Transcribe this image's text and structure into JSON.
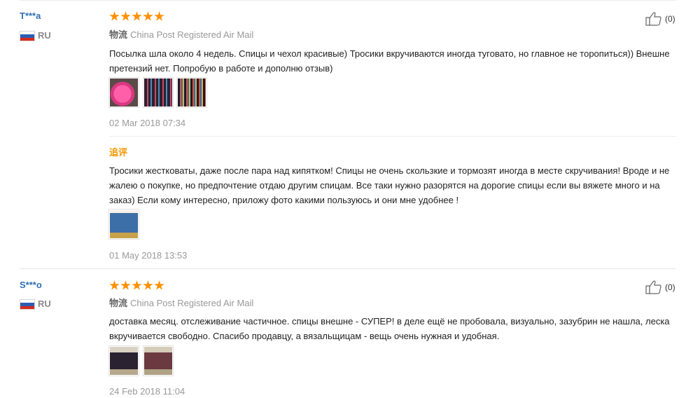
{
  "reviews": [
    {
      "user": "T***a",
      "country": "RU",
      "stars": 5,
      "likes": "(0)",
      "logistics_label": "物流",
      "logistics_value": "China Post Registered Air Mail",
      "text": "Посылка шла около 4 недель. Спицы и чехол красивые) Тросики вкручиваются иногда туговато, но главное не торопиться)) Внешне претензий нет. Попробую в работе и дополню отзыв)",
      "date": "02 Mar 2018 07:34",
      "followup": {
        "title": "追评",
        "text": "Тросики жестковаты, даже после пара над кипятком! Спицы не очень скользкие и тормозят иногда в месте скручивания! Вроде и не жалею о покупке, но предпочтение отдаю другим спицам. Все таки нужно разорятся на дорогие спицы если вы вяжете много и на заказ) Если кому интересно, приложу фото какими пользуюсь и они мне удобнее !",
        "date": "01 May 2018 13:53"
      }
    },
    {
      "user": "S***o",
      "country": "RU",
      "stars": 5,
      "likes": "(0)",
      "logistics_label": "物流",
      "logistics_value": "China Post Registered Air Mail",
      "text": "доставка месяц. отслеживание частичное. спицы внешне - СУПЕР! в деле ещё не пробовала, визуально, зазубрин не нашла, леска вкручивается свободно. Спасибо продавцу, а вязальщицам - вещь очень нужная и удобная.",
      "date": "24 Feb 2018 11:04"
    }
  ],
  "icons": {
    "flag": "russia-flag-icon",
    "like": "thumbs-up-icon",
    "star": "star-icon"
  },
  "colors": {
    "username": "#2f6fb3",
    "star": "#ff9000",
    "followup": "#f39800",
    "muted": "#999999"
  }
}
